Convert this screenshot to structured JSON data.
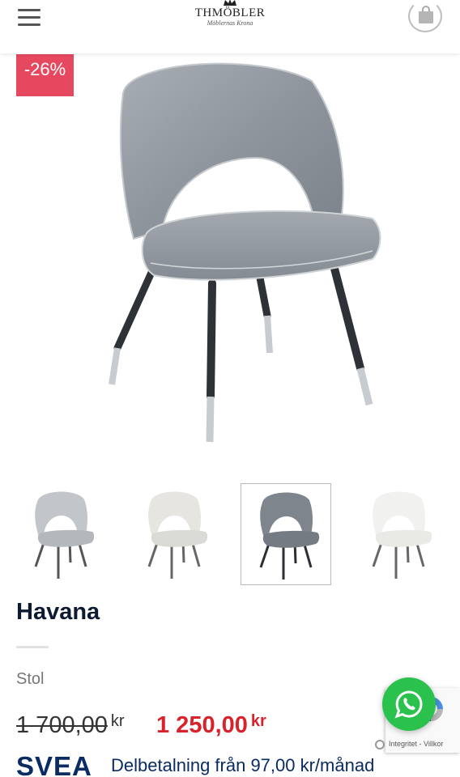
{
  "header": {
    "logo_main": "THMÖBLER",
    "logo_sub": "Möblernas Krona",
    "menu_icon": "hamburger-menu-icon",
    "cart_icon": "shopping-bag-icon"
  },
  "badge": {
    "discount": "-26%",
    "color": "#e5485f"
  },
  "product": {
    "title": "Havana",
    "category": "Stol",
    "old_price": "1 700,00",
    "old_currency": "kr",
    "new_price": "1 250,00",
    "new_currency": "kr",
    "price_color": "#d8232a"
  },
  "thumbnails": [
    {
      "variant": "light-grey"
    },
    {
      "variant": "cream"
    },
    {
      "variant": "dark-grey",
      "selected": true
    },
    {
      "variant": "white"
    }
  ],
  "payment": {
    "provider": "SVEA",
    "installment_text": "Delbetalning från 97,00 kr/månad"
  },
  "recaptcha": {
    "text": "Integritet - Villkor"
  },
  "whatsapp": {
    "icon": "whatsapp-icon",
    "color": "#2bc14d"
  }
}
